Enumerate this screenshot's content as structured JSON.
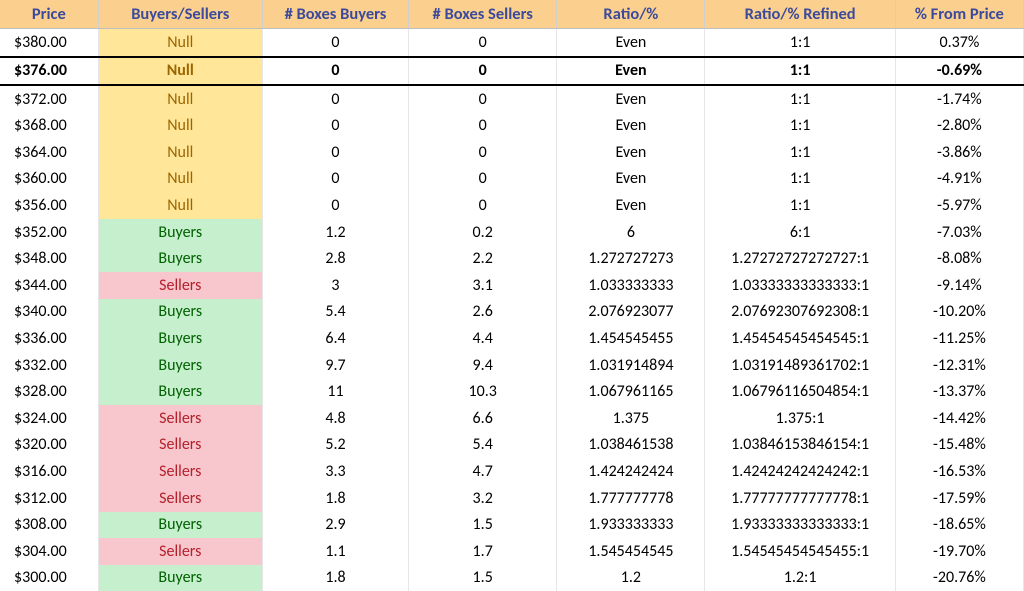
{
  "headers": {
    "price": "Price",
    "bs": "Buyers/Sellers",
    "nb_b": "# Boxes Buyers",
    "nb_s": "# Boxes Sellers",
    "ratio": "Ratio/%",
    "ratio_ref": "Ratio/% Refined",
    "pct_from": "% From Price"
  },
  "rows": [
    {
      "price": "$380.00",
      "bs": "Null",
      "bs_class": "bs-null",
      "nb_b": "0",
      "nb_s": "0",
      "ratio": "Even",
      "ratio_ref": "1:1",
      "pct_from": "0.37%",
      "highlight": false
    },
    {
      "price": "$376.00",
      "bs": "Null",
      "bs_class": "bs-null",
      "nb_b": "0",
      "nb_s": "0",
      "ratio": "Even",
      "ratio_ref": "1:1",
      "pct_from": "-0.69%",
      "highlight": true
    },
    {
      "price": "$372.00",
      "bs": "Null",
      "bs_class": "bs-null",
      "nb_b": "0",
      "nb_s": "0",
      "ratio": "Even",
      "ratio_ref": "1:1",
      "pct_from": "-1.74%",
      "highlight": false
    },
    {
      "price": "$368.00",
      "bs": "Null",
      "bs_class": "bs-null",
      "nb_b": "0",
      "nb_s": "0",
      "ratio": "Even",
      "ratio_ref": "1:1",
      "pct_from": "-2.80%",
      "highlight": false
    },
    {
      "price": "$364.00",
      "bs": "Null",
      "bs_class": "bs-null",
      "nb_b": "0",
      "nb_s": "0",
      "ratio": "Even",
      "ratio_ref": "1:1",
      "pct_from": "-3.86%",
      "highlight": false
    },
    {
      "price": "$360.00",
      "bs": "Null",
      "bs_class": "bs-null",
      "nb_b": "0",
      "nb_s": "0",
      "ratio": "Even",
      "ratio_ref": "1:1",
      "pct_from": "-4.91%",
      "highlight": false
    },
    {
      "price": "$356.00",
      "bs": "Null",
      "bs_class": "bs-null",
      "nb_b": "0",
      "nb_s": "0",
      "ratio": "Even",
      "ratio_ref": "1:1",
      "pct_from": "-5.97%",
      "highlight": false
    },
    {
      "price": "$352.00",
      "bs": "Buyers",
      "bs_class": "bs-buyers",
      "nb_b": "1.2",
      "nb_s": "0.2",
      "ratio": "6",
      "ratio_ref": "6:1",
      "pct_from": "-7.03%",
      "highlight": false
    },
    {
      "price": "$348.00",
      "bs": "Buyers",
      "bs_class": "bs-buyers",
      "nb_b": "2.8",
      "nb_s": "2.2",
      "ratio": "1.272727273",
      "ratio_ref": "1.27272727272727:1",
      "pct_from": "-8.08%",
      "highlight": false
    },
    {
      "price": "$344.00",
      "bs": "Sellers",
      "bs_class": "bs-sellers",
      "nb_b": "3",
      "nb_s": "3.1",
      "ratio": "1.033333333",
      "ratio_ref": "1.03333333333333:1",
      "pct_from": "-9.14%",
      "highlight": false
    },
    {
      "price": "$340.00",
      "bs": "Buyers",
      "bs_class": "bs-buyers",
      "nb_b": "5.4",
      "nb_s": "2.6",
      "ratio": "2.076923077",
      "ratio_ref": "2.07692307692308:1",
      "pct_from": "-10.20%",
      "highlight": false
    },
    {
      "price": "$336.00",
      "bs": "Buyers",
      "bs_class": "bs-buyers",
      "nb_b": "6.4",
      "nb_s": "4.4",
      "ratio": "1.454545455",
      "ratio_ref": "1.45454545454545:1",
      "pct_from": "-11.25%",
      "highlight": false
    },
    {
      "price": "$332.00",
      "bs": "Buyers",
      "bs_class": "bs-buyers",
      "nb_b": "9.7",
      "nb_s": "9.4",
      "ratio": "1.031914894",
      "ratio_ref": "1.03191489361702:1",
      "pct_from": "-12.31%",
      "highlight": false
    },
    {
      "price": "$328.00",
      "bs": "Buyers",
      "bs_class": "bs-buyers",
      "nb_b": "11",
      "nb_s": "10.3",
      "ratio": "1.067961165",
      "ratio_ref": "1.06796116504854:1",
      "pct_from": "-13.37%",
      "highlight": false
    },
    {
      "price": "$324.00",
      "bs": "Sellers",
      "bs_class": "bs-sellers",
      "nb_b": "4.8",
      "nb_s": "6.6",
      "ratio": "1.375",
      "ratio_ref": "1.375:1",
      "pct_from": "-14.42%",
      "highlight": false
    },
    {
      "price": "$320.00",
      "bs": "Sellers",
      "bs_class": "bs-sellers",
      "nb_b": "5.2",
      "nb_s": "5.4",
      "ratio": "1.038461538",
      "ratio_ref": "1.03846153846154:1",
      "pct_from": "-15.48%",
      "highlight": false
    },
    {
      "price": "$316.00",
      "bs": "Sellers",
      "bs_class": "bs-sellers",
      "nb_b": "3.3",
      "nb_s": "4.7",
      "ratio": "1.424242424",
      "ratio_ref": "1.42424242424242:1",
      "pct_from": "-16.53%",
      "highlight": false
    },
    {
      "price": "$312.00",
      "bs": "Sellers",
      "bs_class": "bs-sellers",
      "nb_b": "1.8",
      "nb_s": "3.2",
      "ratio": "1.777777778",
      "ratio_ref": "1.77777777777778:1",
      "pct_from": "-17.59%",
      "highlight": false
    },
    {
      "price": "$308.00",
      "bs": "Buyers",
      "bs_class": "bs-buyers",
      "nb_b": "2.9",
      "nb_s": "1.5",
      "ratio": "1.933333333",
      "ratio_ref": "1.93333333333333:1",
      "pct_from": "-18.65%",
      "highlight": false
    },
    {
      "price": "$304.00",
      "bs": "Sellers",
      "bs_class": "bs-sellers",
      "nb_b": "1.1",
      "nb_s": "1.7",
      "ratio": "1.545454545",
      "ratio_ref": "1.54545454545455:1",
      "pct_from": "-19.70%",
      "highlight": false
    },
    {
      "price": "$300.00",
      "bs": "Buyers",
      "bs_class": "bs-buyers",
      "nb_b": "1.8",
      "nb_s": "1.5",
      "ratio": "1.2",
      "ratio_ref": "1.2:1",
      "pct_from": "-20.76%",
      "highlight": false
    }
  ]
}
